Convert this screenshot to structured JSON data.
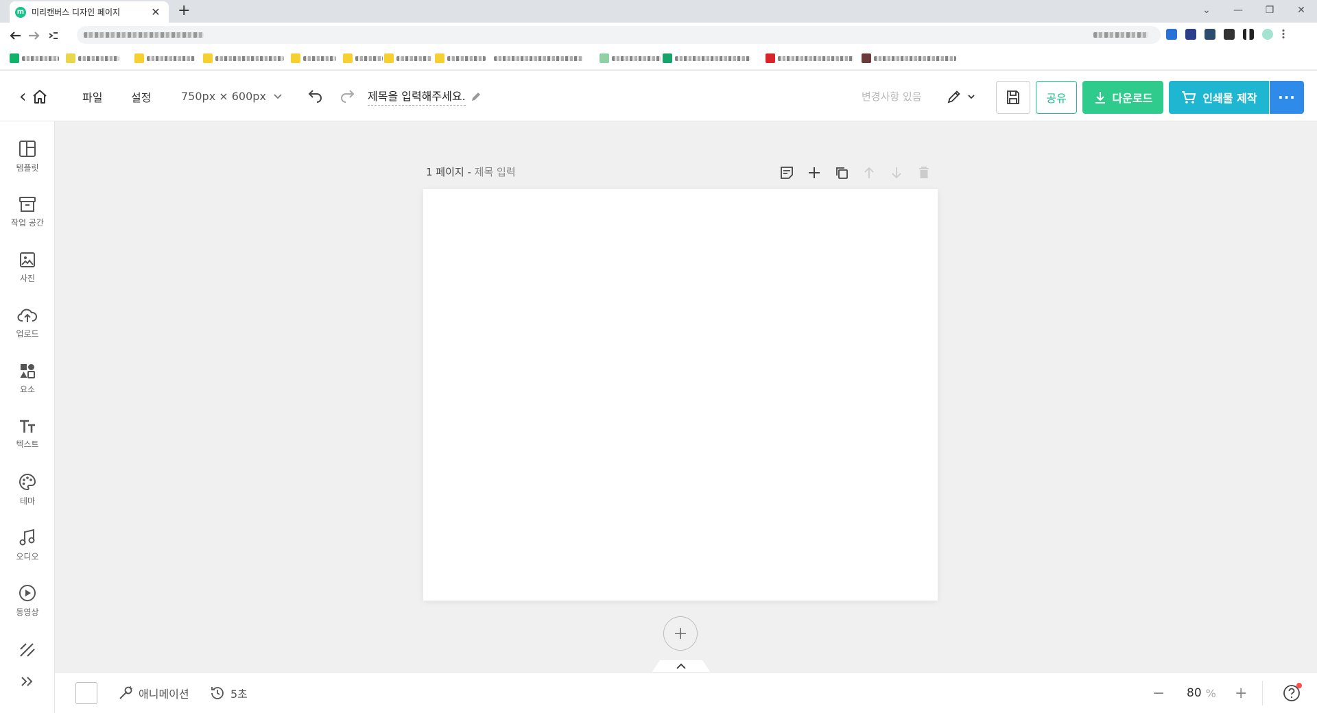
{
  "browser": {
    "tab_title": "미리캔버스 디자인 페이지",
    "tab_favicon_letter": "m",
    "close_glyph": "✕",
    "new_tab_glyph": "+",
    "window_controls": [
      "⌄",
      "—",
      "❐",
      "✕"
    ]
  },
  "header": {
    "back_glyph": "‹",
    "file_menu": "파일",
    "settings_menu": "설정",
    "size_label": "750px × 600px",
    "title_value": "제목을 입력해주세요.",
    "changes_status": "변경사항 있음",
    "share_label": "공유",
    "download_label": "다운로드",
    "print_label": "인쇄물 제작",
    "more_glyph": "···",
    "brand_colors": {
      "green": "#19c38a",
      "download": "#2ecb8c",
      "print": "#1eb6d0",
      "more": "#2e8bea"
    }
  },
  "sidebar": {
    "items": [
      {
        "label": "템플릿",
        "icon": "template-icon"
      },
      {
        "label": "작업 공간",
        "icon": "workspace-icon"
      },
      {
        "label": "사진",
        "icon": "photo-icon"
      },
      {
        "label": "업로드",
        "icon": "upload-icon"
      },
      {
        "label": "요소",
        "icon": "elements-icon"
      },
      {
        "label": "텍스트",
        "icon": "text-icon"
      },
      {
        "label": "테마",
        "icon": "palette-icon"
      },
      {
        "label": "오디오",
        "icon": "audio-icon"
      },
      {
        "label": "동영상",
        "icon": "video-icon"
      }
    ]
  },
  "page": {
    "number_label": "1 페이지 - ",
    "title_placeholder": "제목 입력"
  },
  "bottom": {
    "animation_label": "애니메이션",
    "time_label": "5초",
    "zoom_minus": "−",
    "zoom_value": "80",
    "zoom_unit": "%",
    "zoom_plus": "+"
  }
}
